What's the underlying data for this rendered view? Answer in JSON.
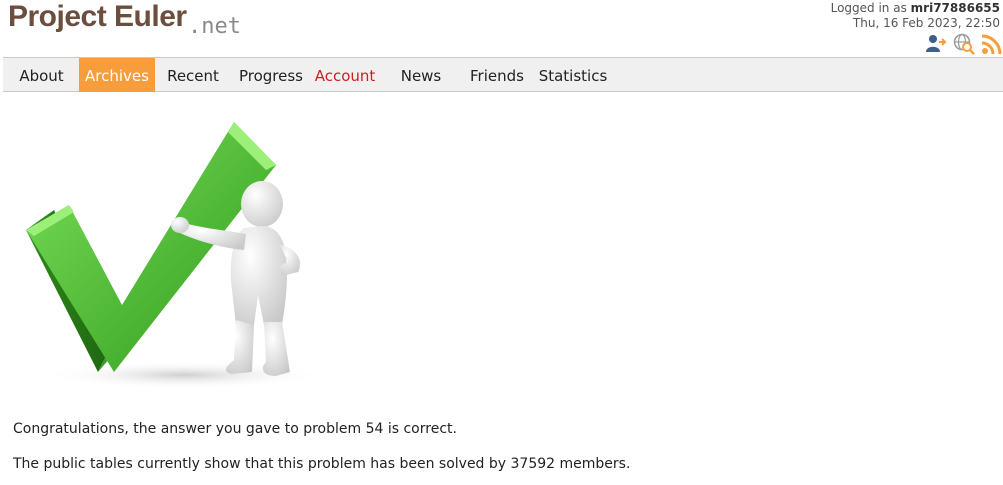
{
  "header": {
    "logo_text": "Project Euler",
    "logo_suffix": ".net",
    "logged_in_prefix": "Logged in as",
    "username": "mri77886655",
    "datetime": "Thu, 16 Feb 2023, 22:50",
    "icons": [
      "account-icon",
      "globe-search-icon",
      "rss-icon"
    ]
  },
  "nav": {
    "items": [
      {
        "label": "About"
      },
      {
        "label": "Archives"
      },
      {
        "label": "Recent"
      },
      {
        "label": "Progress"
      },
      {
        "label": "Account"
      },
      {
        "label": "News"
      },
      {
        "label": "Friends"
      },
      {
        "label": "Statistics"
      }
    ],
    "active_color": "#f89d3c",
    "account_color": "#cc1f1f"
  },
  "main": {
    "image": "correct-checkmark-figure",
    "message": "Congratulations, the answer you gave to problem 54 is correct.",
    "solved_text": "The public tables currently show that this problem has been solved by 37592 members."
  }
}
